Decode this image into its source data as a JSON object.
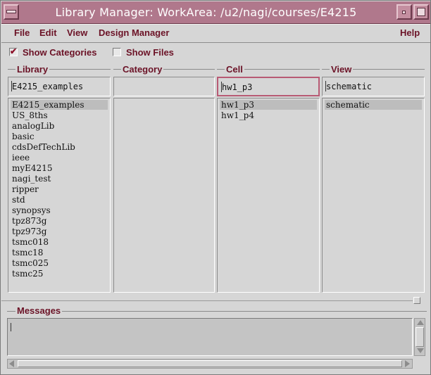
{
  "window": {
    "title": "Library Manager: WorkArea: /u2/nagi/courses/E4215"
  },
  "menu": {
    "file": "File",
    "edit": "Edit",
    "view": "View",
    "design_manager": "Design Manager",
    "help": "Help"
  },
  "options": {
    "show_categories": {
      "label": "Show Categories",
      "checked": true
    },
    "show_files": {
      "label": "Show Files",
      "checked": false
    }
  },
  "columns": {
    "library": {
      "header": "Library",
      "value": "E4215_examples",
      "items": [
        "E4215_examples",
        "US_8ths",
        "analogLib",
        "basic",
        "cdsDefTechLib",
        "ieee",
        "myE4215",
        "nagi_test",
        "ripper",
        "std",
        "synopsys",
        "tpz873g",
        "tpz973g",
        "tsmc018",
        "tsmc18",
        "tsmc025",
        "tsmc25"
      ],
      "selected": "E4215_examples"
    },
    "category": {
      "header": "Category",
      "value": "",
      "items": []
    },
    "cell": {
      "header": "Cell",
      "value": "hw1_p3",
      "items": [
        "hw1_p3",
        "hw1_p4"
      ],
      "selected": "hw1_p3"
    },
    "view": {
      "header": "View",
      "value": "schematic",
      "items": [
        "schematic"
      ],
      "selected": "schematic"
    }
  },
  "messages": {
    "header": "Messages",
    "text": ""
  },
  "colors": {
    "title_bar": "#b0788c",
    "label_text": "#6b1226",
    "background": "#d6d6d6",
    "active_field_border": "#b85a74"
  }
}
